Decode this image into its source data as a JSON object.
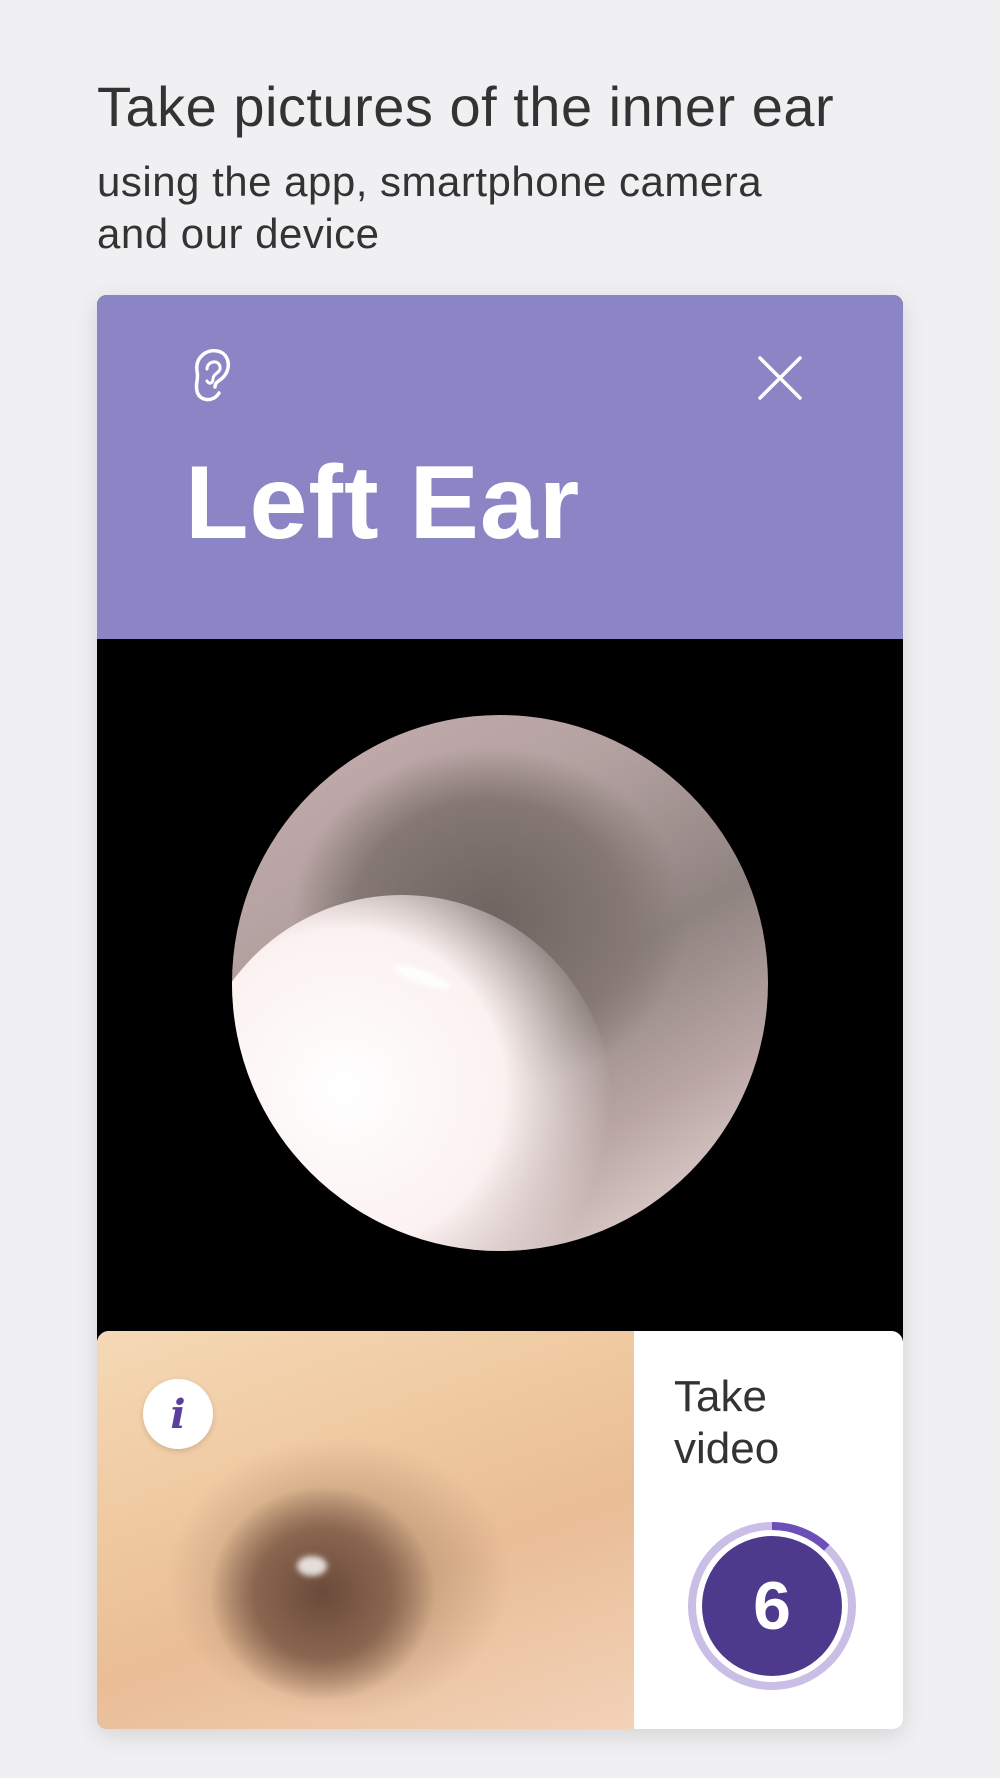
{
  "intro": {
    "headline": "Take pictures of the inner ear",
    "subline_1": "using the app, smartphone camera",
    "subline_2": "and our device"
  },
  "card": {
    "title": "Left Ear",
    "header_icon": "ear-icon",
    "close_icon": "close-icon",
    "info_icon": "info-icon",
    "info_glyph": "i",
    "action_line_1": "Take",
    "action_line_2": "video",
    "counter": "6",
    "counter_progress": 0.12,
    "colors": {
      "header": "#8b85c6",
      "counter_fill": "#4e3a8c",
      "counter_ring": "#c9bfe6",
      "counter_ring_progress": "#6d4fb8",
      "info_glyph": "#5b3fa0"
    }
  }
}
